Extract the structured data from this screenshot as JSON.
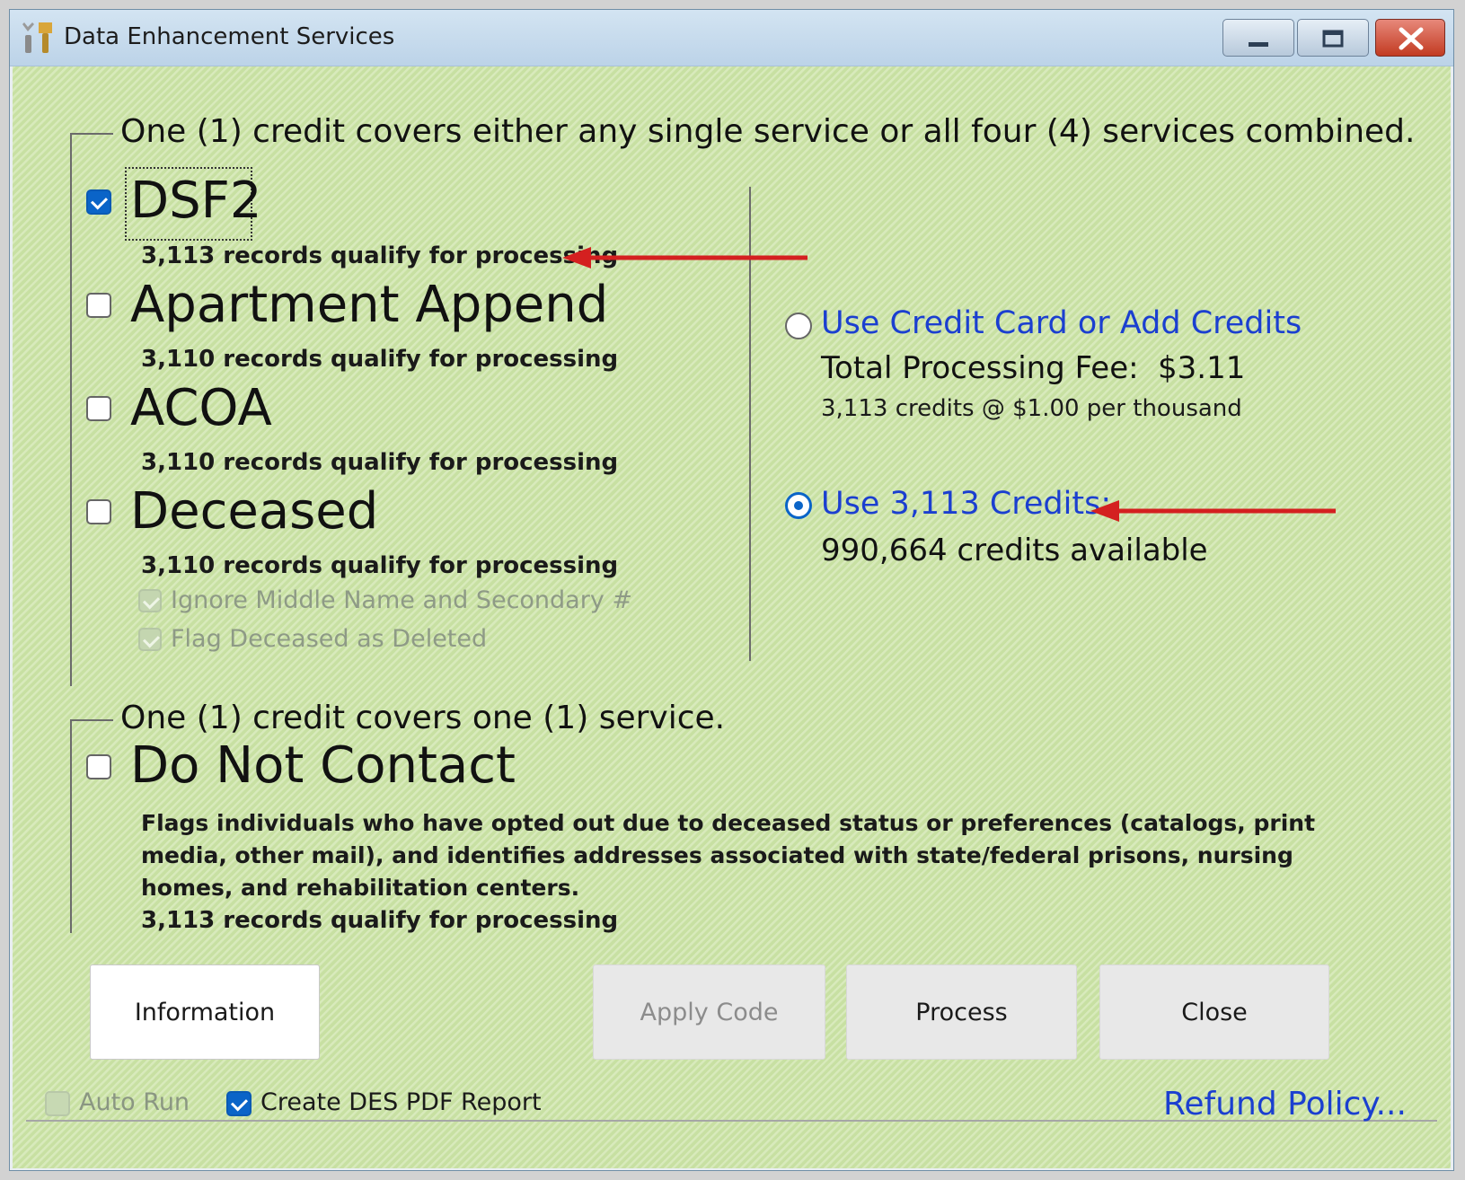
{
  "window": {
    "title": "Data Enhancement Services",
    "icon": "tools-icon"
  },
  "group1": {
    "caption": "One (1) credit covers either any single service or all four (4) services combined.",
    "services": [
      {
        "label": "DSF2",
        "checked": true,
        "sub": "3,113 records qualify for processing"
      },
      {
        "label": "Apartment Append",
        "checked": false,
        "sub": "3,110 records qualify for processing"
      },
      {
        "label": "ACOA",
        "checked": false,
        "sub": "3,110 records qualify for processing"
      },
      {
        "label": "Deceased",
        "checked": false,
        "sub": "3,110 records qualify for processing"
      }
    ],
    "deceased_options": [
      {
        "label": "Ignore Middle Name and Secondary #",
        "checked": true,
        "enabled": false
      },
      {
        "label": "Flag Deceased as Deleted",
        "checked": true,
        "enabled": false
      }
    ]
  },
  "payment": {
    "card_option": {
      "label": "Use Credit Card or Add Credits",
      "selected": false,
      "fee_label": "Total Processing Fee:",
      "fee_value": "$3.11",
      "fee_detail": "3,113 credits @ $1.00 per thousand"
    },
    "credits_option": {
      "label": "Use 3,113 Credits:",
      "selected": true,
      "available": "990,664 credits available"
    }
  },
  "group2": {
    "caption": "One (1) credit covers one (1) service.",
    "service": {
      "label": "Do Not Contact",
      "checked": false,
      "description": "Flags individuals who have opted out due to deceased status or preferences (catalogs, print media, other mail), and identifies addresses associated with state/federal prisons, nursing homes, and rehabilitation centers.",
      "sub": "3,113 records qualify for processing"
    }
  },
  "buttons": {
    "information": "Information",
    "apply_code": "Apply Code",
    "process": "Process",
    "close": "Close"
  },
  "footer": {
    "auto_run": {
      "label": "Auto Run",
      "checked": false,
      "enabled": false
    },
    "create_pdf": {
      "label": "Create DES PDF Report",
      "checked": true,
      "enabled": true
    },
    "refund_link": "Refund Policy..."
  },
  "colors": {
    "background": "#cde4a9",
    "link": "#1b3fd0",
    "accent": "#0a64c8",
    "annotation_arrow": "#d42020"
  }
}
